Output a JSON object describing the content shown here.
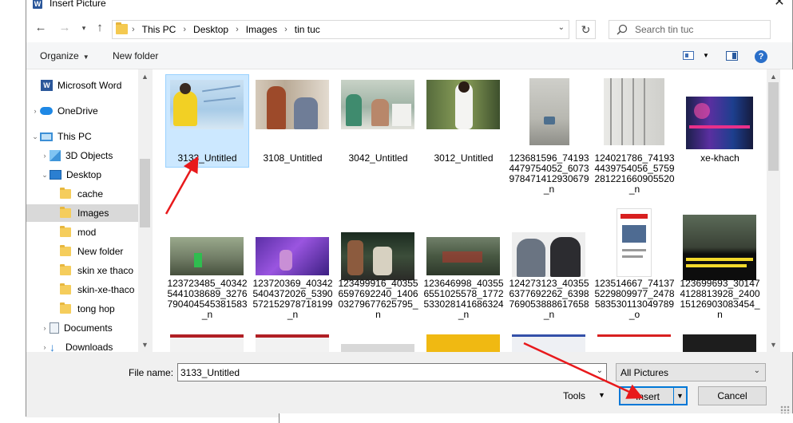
{
  "window": {
    "title": "Insert Picture",
    "app_icon": "W"
  },
  "nav": {
    "breadcrumbs": [
      "This PC",
      "Desktop",
      "Images",
      "tin tuc"
    ],
    "search_placeholder": "Search tin tuc"
  },
  "toolbar": {
    "organize": "Organize",
    "new_folder": "New folder",
    "help": "?"
  },
  "sidebar": {
    "items": [
      {
        "label": "Microsoft Word",
        "icon": "word-icon"
      },
      {
        "label": "OneDrive",
        "icon": "onedrive-icon"
      },
      {
        "label": "This PC",
        "icon": "this-pc-icon"
      },
      {
        "label": "3D Objects",
        "icon": "3d-objects-icon"
      },
      {
        "label": "Desktop",
        "icon": "desktop-icon"
      },
      {
        "label": "cache",
        "icon": "folder-icon"
      },
      {
        "label": "Images",
        "icon": "folder-icon"
      },
      {
        "label": "mod",
        "icon": "folder-icon"
      },
      {
        "label": "New folder",
        "icon": "folder-icon"
      },
      {
        "label": "skin xe thaco",
        "icon": "folder-icon"
      },
      {
        "label": "skin-xe-thaco",
        "icon": "folder-icon"
      },
      {
        "label": "tong hop",
        "icon": "folder-icon"
      },
      {
        "label": "Documents",
        "icon": "documents-icon"
      },
      {
        "label": "Downloads",
        "icon": "downloads-icon"
      }
    ]
  },
  "files": {
    "row1": [
      "3133_Untitled",
      "3108_Untitled",
      "3042_Untitled",
      "3012_Untitled",
      "123681596_741934479754052_6073978471412930679_n",
      "124021786_741934439754056_5759281221660905520_n",
      "xe-khach"
    ],
    "row2": [
      "123723485_403425441038689_3276790404545381583_n",
      "123720369_403425404372026_5390572152978718199_n",
      "123499916_403556597692240_140603279677625795_n",
      "123646998_403556551025578_1772533028141686324_n",
      "124273123_403556377692262_6398769053888617658_n",
      "123514667_741375229809977_2478583530113049789_o",
      "123699693_301474128813928_240015126903083454_n"
    ],
    "row3_count": 7
  },
  "bottom": {
    "file_name_label": "File name:",
    "file_name_value": "3133_Untitled",
    "filter": "All Pictures",
    "tools": "Tools",
    "insert": "Insert",
    "cancel": "Cancel"
  },
  "colors": {
    "selection_fill": "#cce8ff",
    "selection_border": "#99d1ff",
    "accent": "#0078d7",
    "annotation_arrow": "#e8191c"
  }
}
